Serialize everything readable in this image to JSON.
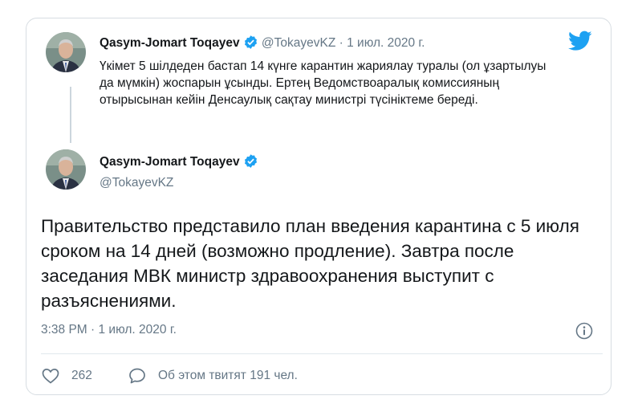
{
  "quoted_tweet": {
    "author_name": "Qasym-Jomart Toqayev",
    "handle": "@TokayevKZ",
    "separator": "·",
    "date": "1 июл. 2020 г.",
    "text": "Үкімет 5 шілдеден бастап 14 күнге карантин жариялау туралы (ол ұзартылуы да мүмкін) жоспарын ұсынды. Ертең Ведомствоаралық комиссияның отырысынан кейін Денсаулық сақтау министрі түсініктеме береді."
  },
  "main_tweet": {
    "author_name": "Qasym-Jomart Toqayev",
    "handle": "@TokayevKZ",
    "text": "Правительство представило план введения карантина с 5 июля сроком на 14 дней (возможно продление). Завтра после заседания МВК министр здравоохранения выступит с разъяснениями.",
    "timestamp": "3:38 PM · 1 июл. 2020 г."
  },
  "actions": {
    "like_count": "262",
    "discussion_label": "Об этом твитят 191 чел."
  },
  "colors": {
    "twitter_blue": "#1da1f2",
    "muted_text": "#657786",
    "border": "#d7dde2"
  },
  "icons": [
    "twitter-bird-icon",
    "verified-badge-icon",
    "info-icon",
    "heart-icon",
    "speech-bubble-icon"
  ]
}
